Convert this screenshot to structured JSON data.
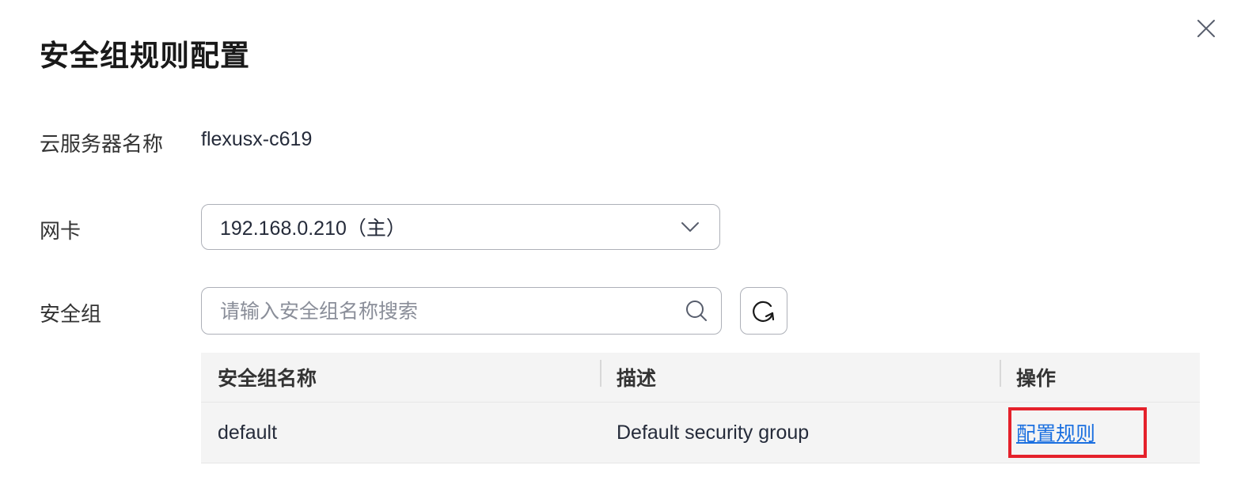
{
  "dialog": {
    "title": "安全组规则配置"
  },
  "fields": {
    "server_name_label": "云服务器名称",
    "server_name_value": "flexusx-c619",
    "nic_label": "网卡",
    "nic_selected": "192.168.0.210（主）",
    "security_group_label": "安全组"
  },
  "search": {
    "placeholder": "请输入安全组名称搜索"
  },
  "table": {
    "columns": [
      "安全组名称",
      "描述",
      "操作"
    ],
    "rows": [
      {
        "name": "default",
        "description": "Default security group",
        "action": "配置规则"
      }
    ]
  },
  "icons": {
    "close": "close-icon",
    "dropdown": "chevron-down-icon",
    "search": "search-icon",
    "refresh": "refresh-icon"
  },
  "colors": {
    "link": "#1a6fe0",
    "highlight": "#e5212b",
    "table_bg": "#f4f4f4"
  }
}
